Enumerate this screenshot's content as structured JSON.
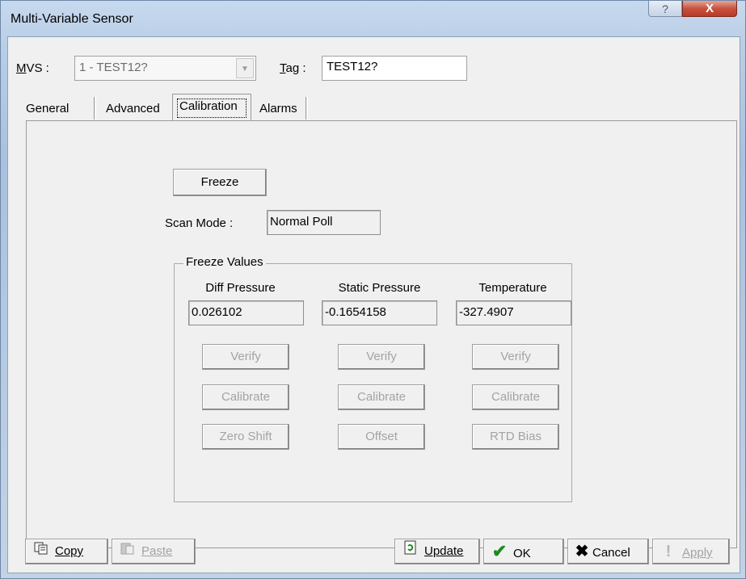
{
  "window": {
    "title": "Multi-Variable Sensor",
    "help_glyph": "?",
    "close_glyph": "X"
  },
  "header": {
    "mvs_label": "MVS :",
    "mvs_value": "1 - TEST12?",
    "tag_label": "Tag :",
    "tag_value": "TEST12?"
  },
  "tabs": [
    {
      "label": "General"
    },
    {
      "label": "Advanced"
    },
    {
      "label": "Calibration",
      "active": true
    },
    {
      "label": "Alarms"
    }
  ],
  "calibration": {
    "freeze_button": "Freeze",
    "scan_mode_label": "Scan Mode :",
    "scan_mode_value": "Normal Poll",
    "group_title": "Freeze Values",
    "columns": [
      {
        "header": "Diff Pressure",
        "value": "0.026102",
        "verify": "Verify",
        "calibrate": "Calibrate",
        "extra": "Zero Shift"
      },
      {
        "header": "Static Pressure",
        "value": "-0.1654158",
        "verify": "Verify",
        "calibrate": "Calibrate",
        "extra": "Offset"
      },
      {
        "header": "Temperature",
        "value": "-327.4907",
        "verify": "Verify",
        "calibrate": "Calibrate",
        "extra": "RTD Bias"
      }
    ]
  },
  "footer": {
    "copy": "Copy",
    "paste": "Paste",
    "update": "Update",
    "ok": "OK",
    "cancel": "Cancel",
    "apply": "Apply"
  },
  "icons": {
    "copy": "copy-icon",
    "paste": "paste-icon",
    "update": "update-icon",
    "ok": "checkmark-icon",
    "cancel": "x-icon",
    "apply": "exclamation-icon"
  },
  "colors": {
    "ok_check": "#1f8a1f",
    "cancel_x": "#1a1a1a",
    "close_button": "#c8523f"
  }
}
